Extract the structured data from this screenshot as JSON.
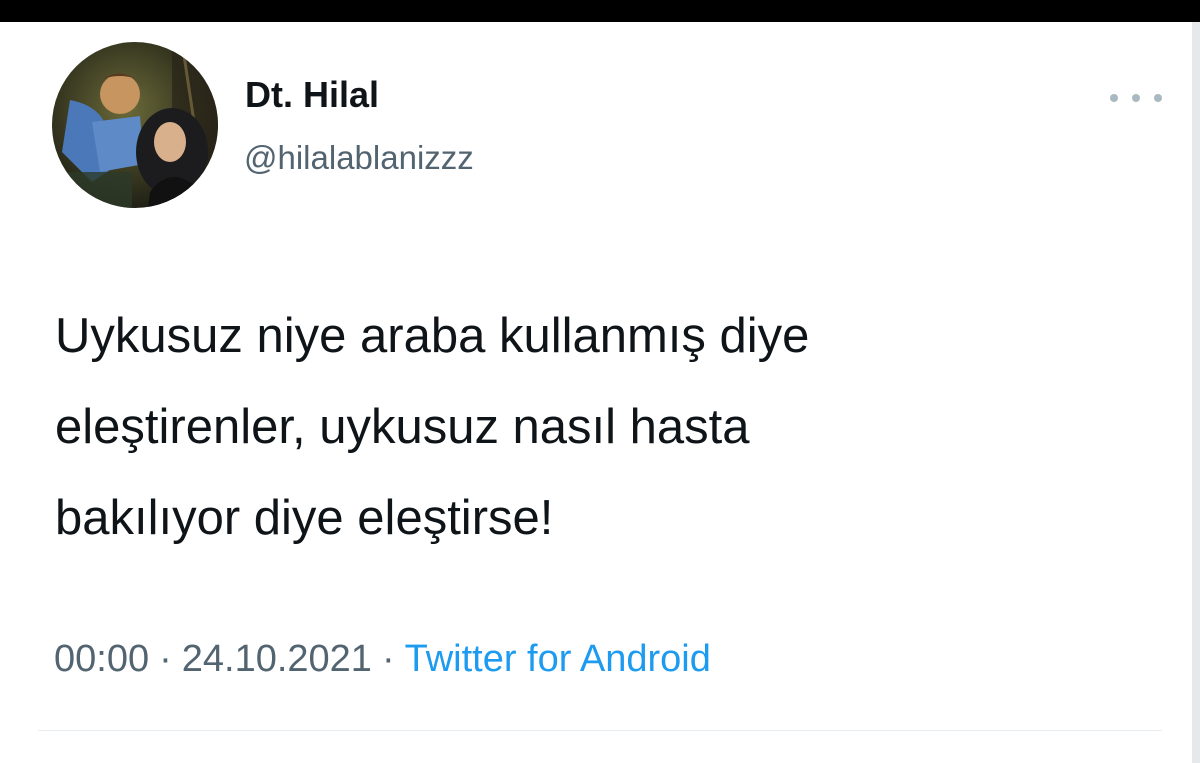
{
  "author": {
    "display_name": "Dt. Hilal",
    "handle": "@hilalablanizzz",
    "avatar_icon": "profile-photo"
  },
  "more_icon": "more-horizontal-icon",
  "tweet": {
    "lines": [
      "Uykusuz niye araba kullanmış diye",
      "eleştirenler, uykusuz nasıl hasta",
      "bakılıyor diye eleştirse!"
    ]
  },
  "meta": {
    "time": "00:00",
    "separator": "·",
    "date": "24.10.2021",
    "source": "Twitter for Android"
  },
  "colors": {
    "text": "#0f1419",
    "muted": "#536471",
    "link": "#1d9bf0"
  }
}
